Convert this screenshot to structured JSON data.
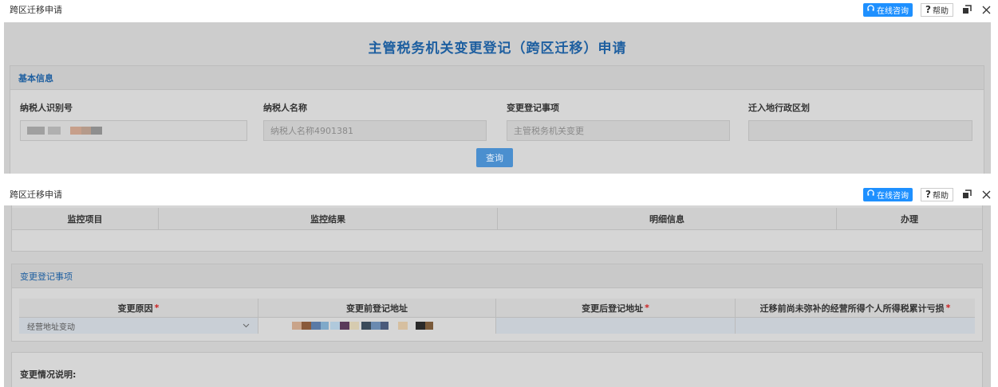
{
  "window": {
    "title": "跨区迁移申请",
    "consult_label": "在线咨询",
    "help_label": "帮助"
  },
  "page": {
    "title": "主管税务机关变更登记（跨区迁移）申请"
  },
  "basic_info": {
    "section_title": "基本信息",
    "fields": [
      {
        "label": "纳税人识别号",
        "value": ""
      },
      {
        "label": "纳税人名称",
        "placeholder": "纳税人名称4901381"
      },
      {
        "label": "变更登记事项",
        "placeholder": "主管税务机关变更"
      },
      {
        "label": "迁入地行政区划",
        "value": ""
      }
    ],
    "query_label": "查询"
  },
  "monitor_table": {
    "columns": [
      "监控项目",
      "监控结果",
      "明细信息",
      "办理"
    ]
  },
  "change_items": {
    "section_title": "变更登记事项",
    "columns": [
      {
        "label": "变更原因",
        "required": "*"
      },
      {
        "label": "变更前登记地址",
        "required": ""
      },
      {
        "label": "变更后登记地址",
        "required": "*"
      },
      {
        "label": "迁移前尚未弥补的经营所得个人所得税累计亏损",
        "required": "*"
      }
    ],
    "reason_value": "经营地址变动"
  },
  "change_desc": {
    "label": "变更情况说明:"
  },
  "colors": {
    "accent": "#1e90ff",
    "title_blue": "#1e5fa0",
    "required_red": "#cc2222"
  }
}
